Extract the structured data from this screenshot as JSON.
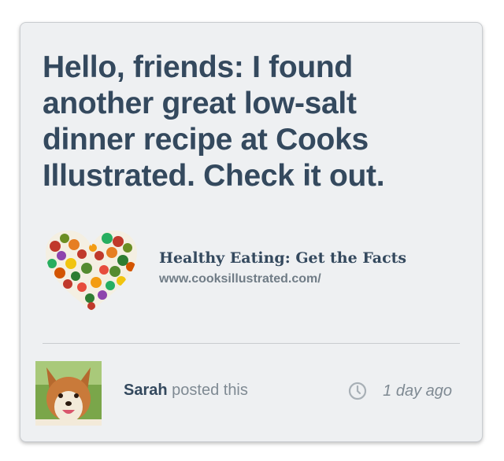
{
  "post": {
    "message": "Hello, friends: I found another great low-salt dinner recipe at Cooks Illustrated. Check it out."
  },
  "link_preview": {
    "image_icon": "vegetable-heart-image",
    "title": "Healthy Eating: Get the Facts",
    "url": "www.cooksillustrated.com/"
  },
  "footer": {
    "avatar_icon": "corgi-puppy-photo",
    "author": "Sarah",
    "action_text": " posted this",
    "clock_icon": "clock-icon",
    "timestamp": "1 day ago"
  },
  "colors": {
    "card_background": "#eef0f2",
    "heading_text": "#34495e",
    "muted_text": "#7f8a93"
  }
}
